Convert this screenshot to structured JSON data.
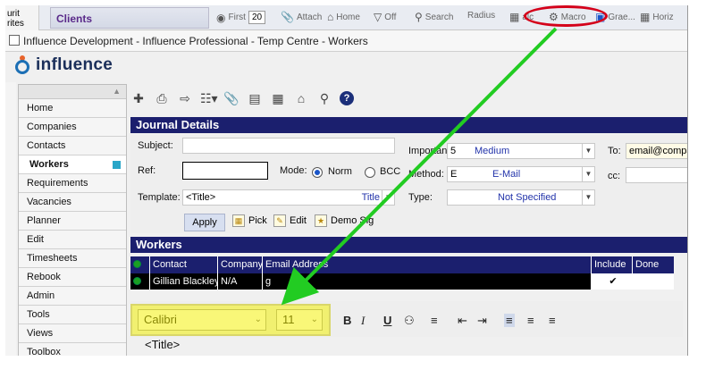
{
  "topbar": {
    "clipped_text": "urit\nrites",
    "clients_label": "Clients",
    "items": {
      "first_label": "First",
      "first_value": "20",
      "attach_label": "Attach",
      "home_label": "Home",
      "off_label": "Off",
      "search_label": "Search",
      "radius_label": "Radius",
      "calc_label": "alc",
      "macro_label": "Macro",
      "graph_label": "Grae...",
      "horiz_label": "Horiz"
    }
  },
  "window": {
    "title": "Influence Development - Influence Professional - Temp Centre - Workers"
  },
  "logo": {
    "word": "influence"
  },
  "nav": {
    "items": [
      {
        "label": "Home"
      },
      {
        "label": "Companies"
      },
      {
        "label": "Contacts"
      },
      {
        "label": "Workers"
      },
      {
        "label": "Requirements"
      },
      {
        "label": "Vacancies"
      },
      {
        "label": "Planner"
      },
      {
        "label": "Edit"
      },
      {
        "label": "Timesheets"
      },
      {
        "label": "Rebook"
      },
      {
        "label": "Admin"
      },
      {
        "label": "Tools"
      },
      {
        "label": "Views"
      },
      {
        "label": "Toolbox"
      }
    ]
  },
  "journal": {
    "header": "Journal Details",
    "subject_label": "Subject:",
    "subject_value": "",
    "ref_label": "Ref:",
    "ref_value": "",
    "mode_label": "Mode:",
    "mode_norm": "Norm",
    "mode_bcc": "BCC",
    "template_label": "Template:",
    "template_value": "<Title>",
    "template_title_link": "Title",
    "importance_label": "Importance:",
    "importance_num": "5",
    "importance_value": "Medium",
    "method_label": "Method:",
    "method_code": "E",
    "method_value": "E-Mail",
    "type_label": "Type:",
    "type_value": "Not Specified",
    "to_label": "To:",
    "to_value": "email@compa",
    "cc_label": "cc:",
    "cc_value": "",
    "apply_label": "Apply",
    "pick_label": "Pick",
    "edit_label": "Edit",
    "demo_label": "Demo Sig"
  },
  "workers": {
    "header": "Workers",
    "columns": [
      "Contact",
      "Company",
      "Email Address",
      "Include",
      "Done"
    ],
    "rows": [
      {
        "contact": "Gillian Blackley",
        "company": "N/A",
        "email": "g",
        "include": "✔",
        "done": ""
      }
    ]
  },
  "editor": {
    "font": "Calibri",
    "size": "11",
    "bold": "B",
    "italic": "I",
    "underline": "U",
    "body_text": "<Title>"
  },
  "colors": {
    "section_header": "#1b1f6e",
    "highlight": "#f5f20a",
    "arrow": "#22cc22",
    "oval": "#d4001a"
  }
}
